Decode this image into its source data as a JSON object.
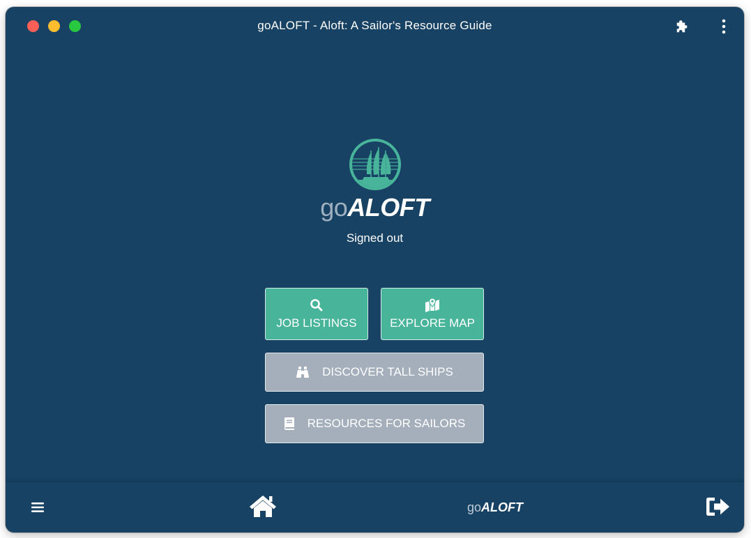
{
  "window": {
    "title": "goALOFT - Aloft: A Sailor's Resource Guide"
  },
  "titlebar": {
    "icons": [
      "puzzle-icon",
      "kebab-menu-icon"
    ]
  },
  "brand": {
    "go": "go",
    "aloft": "ALOFT"
  },
  "status": "Signed out",
  "buttons": {
    "job_listings": {
      "label": "JOB LISTINGS",
      "icon": "search-icon"
    },
    "explore_map": {
      "label": "EXPLORE MAP",
      "icon": "map-marker-icon"
    },
    "discover_tall_ships": {
      "label": "DISCOVER TALL SHIPS",
      "icon": "binoculars-icon"
    },
    "resources_for_sailors": {
      "label": "RESOURCES FOR SAILORS",
      "icon": "book-icon"
    }
  },
  "bottombar": {
    "icons": [
      "hamburger-menu-icon",
      "home-icon",
      "sign-out-icon"
    ],
    "brand_go": "go",
    "brand_aloft": "ALOFT"
  },
  "colors": {
    "background": "#174263",
    "teal": "#48b59b",
    "gray_button": "#a4afbb",
    "traffic_red": "#ff5f57",
    "traffic_yellow": "#febc2e",
    "traffic_green": "#28c840"
  }
}
